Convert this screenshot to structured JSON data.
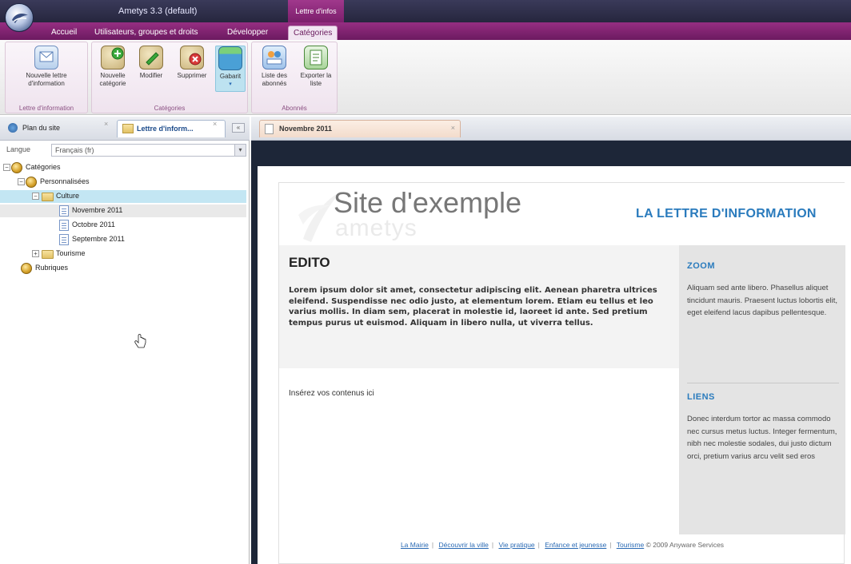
{
  "titlebar": {
    "app_title": "Ametys 3.3 (default)",
    "context_title": "Lettre d'infos"
  },
  "ribbon_tabs": [
    {
      "label": "Accueil"
    },
    {
      "label": "Utilisateurs, groupes et droits"
    },
    {
      "label": "Développer"
    },
    {
      "label": "Catégories"
    }
  ],
  "ribbon": {
    "groups": [
      {
        "label": "Lettre d'information"
      },
      {
        "label": "Catégories"
      },
      {
        "label": "Abonnés"
      }
    ],
    "buttons": {
      "new_letter": "Nouvelle lettre d'information",
      "new_category": "Nouvelle catégorie",
      "edit": "Modifier",
      "delete": "Supprimer",
      "template": "Gabarit",
      "subscribers_list": "Liste des abonnés",
      "export_list": "Exporter la liste"
    }
  },
  "left_panel": {
    "tabs": [
      {
        "label": "Plan du site"
      },
      {
        "label": "Lettre d'inform..."
      }
    ],
    "language_label": "Langue",
    "language_value": "Français (fr)",
    "tree": {
      "root": "Catégories",
      "personal": "Personnalisées",
      "culture": "Culture",
      "nov": "Novembre 2011",
      "oct": "Octobre 2011",
      "sep": "Septembre 2011",
      "tourisme": "Tourisme",
      "rubriques": "Rubriques"
    }
  },
  "document_tab": {
    "label": "Novembre 2011"
  },
  "newsletter": {
    "site_title": "Site d'exemple",
    "site_sub": "ametys",
    "banner": "LA LETTRE D'INFORMATION",
    "edito_title": "EDITO",
    "edito_text": "Lorem ipsum dolor sit amet, consectetur adipiscing elit. Aenean pharetra ultrices eleifend. Suspendisse nec odio justo, at elementum lorem. Etiam eu tellus et leo varius mollis. In diam sem, placerat in molestie id, laoreet id ante. Sed pretium tempus purus ut euismod. Aliquam in libero nulla, ut viverra tellus.",
    "content_placeholder": "Insérez vos contenus ici",
    "zoom_title": "ZOOM",
    "zoom_text": "Aliquam sed ante libero. Phasellus aliquet tincidunt mauris. Praesent luctus lobortis elit, eget eleifend lacus dapibus pellentesque.",
    "links_title": "LIENS",
    "links_text": "Donec interdum tortor ac massa commodo nec cursus metus luctus. Integer fermentum, nibh nec molestie sodales, dui justo dictum orci, pretium varius arcu velit sed eros",
    "footer_links": [
      "La Mairie",
      "Découvrir la ville",
      "Vie pratique",
      "Enfance et jeunesse",
      "Tourisme"
    ],
    "footer_copyright": "© 2009 Anyware Services"
  },
  "colors": {
    "ribbon_accent": "#7c1f6c",
    "link_blue": "#2a7bbd",
    "selection": "#c3e6f3"
  }
}
